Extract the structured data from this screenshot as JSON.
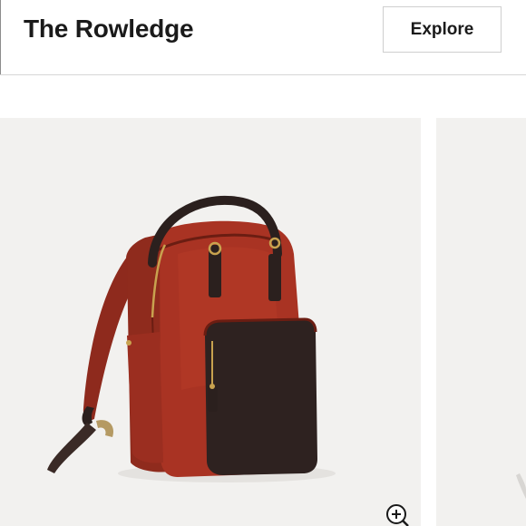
{
  "header": {
    "title": "The Rowledge",
    "explore_label": "Explore"
  },
  "gallery": {
    "main_image_alt": "Red backpack with dark brown leather front pocket",
    "zoom_icon": "zoom-in-icon"
  },
  "colors": {
    "backpack_red": "#a93323",
    "leather_brown": "#2e2220",
    "background_gray": "#f2f1ef"
  }
}
